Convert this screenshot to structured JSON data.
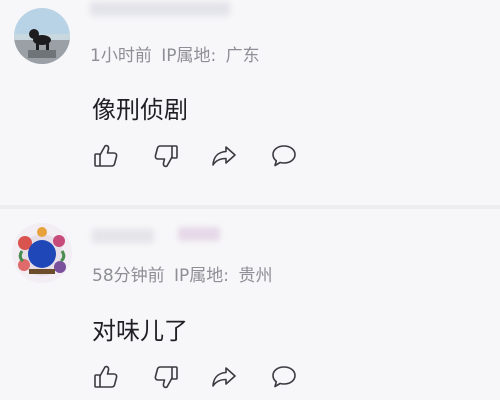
{
  "comments": [
    {
      "time": "1小时前",
      "ip_label": "IP属地:",
      "ip_location": "广东",
      "text": "像刑侦剧",
      "avatar_icon": "dog-photo-avatar"
    },
    {
      "time": "58分钟前",
      "ip_label": "IP属地:",
      "ip_location": "贵州",
      "text": "对味儿了",
      "avatar_icon": "floral-frame-avatar"
    }
  ],
  "actions": {
    "like_icon": "thumbs-up-icon",
    "dislike_icon": "thumbs-down-icon",
    "share_icon": "share-icon",
    "reply_icon": "comment-bubble-icon"
  },
  "colors": {
    "background": "#f7f7f9",
    "meta_text": "#8e8e96",
    "body_text": "#1f1f24",
    "icon_stroke": "#3a3a40"
  }
}
